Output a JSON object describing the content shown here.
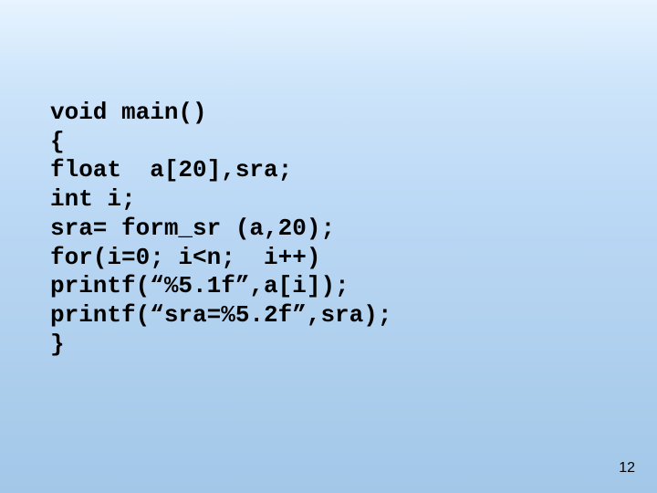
{
  "slide": {
    "code": "void main()\n{\nfloat  a[20],sra;\nint i;\nsra= form_sr (a,20);\nfor(i=0; i<n;  i++)\nprintf(“%5.1f”,a[i]);\nprintf(“sra=%5.2f”,sra);\n}",
    "page_number": "12"
  }
}
